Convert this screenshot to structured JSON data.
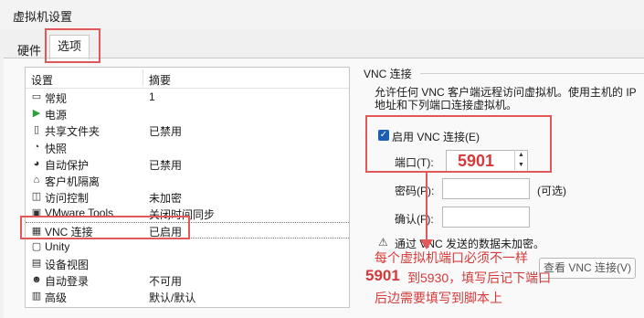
{
  "window": {
    "title": "虚拟机设置"
  },
  "tabs": [
    {
      "label": "硬件"
    },
    {
      "label": "选项"
    }
  ],
  "list": {
    "header_setting": "设置",
    "header_summary": "摘要",
    "rows": [
      {
        "icon": "general-icon",
        "glyph": "▭",
        "label": "常规",
        "summary": "1"
      },
      {
        "icon": "power-icon",
        "glyph": "▶",
        "label": "电源",
        "summary": ""
      },
      {
        "icon": "shared-folder-icon",
        "glyph": "▯",
        "label": "共享文件夹",
        "summary": "已禁用"
      },
      {
        "icon": "snapshot-icon",
        "glyph": "◔",
        "label": "快照",
        "summary": ""
      },
      {
        "icon": "autoprotect-icon",
        "glyph": "◕",
        "label": "自动保护",
        "summary": "已禁用"
      },
      {
        "icon": "lock-icon",
        "glyph": "⌂",
        "label": "客户机隔离",
        "summary": ""
      },
      {
        "icon": "access-control-icon",
        "glyph": "◫",
        "label": "访问控制",
        "summary": "未加密"
      },
      {
        "icon": "vmware-tools-icon",
        "glyph": "▣",
        "label": "VMware Tools",
        "summary": "关闭时间同步"
      },
      {
        "icon": "vnc-icon",
        "glyph": "▦",
        "label": "VNC 连接",
        "summary": "已启用"
      },
      {
        "icon": "unity-icon",
        "glyph": "▢",
        "label": "Unity",
        "summary": ""
      },
      {
        "icon": "device-view-icon",
        "glyph": "▤",
        "label": "设备视图",
        "summary": ""
      },
      {
        "icon": "autologin-icon",
        "glyph": "☻",
        "label": "自动登录",
        "summary": "不可用"
      },
      {
        "icon": "advanced-icon",
        "glyph": "▥",
        "label": "高级",
        "summary": "默认/默认"
      }
    ]
  },
  "vnc": {
    "group_title": "VNC 连接",
    "description": "允许任何 VNC 客户端远程访问虚拟机。使用主机的 IP 地址和下列端口连接虚拟机。",
    "enable_label": "启用 VNC 连接(E)",
    "port_label": "端口(T):",
    "port_value": "5901",
    "password_label": "密码(P):",
    "optional_label": "(可选)",
    "confirm_label": "确认(F):",
    "warning_text": "通过 VNC 发送的数据未加密。",
    "view_button": "查看 VNC 连接(V)"
  },
  "annotations": {
    "line1": "每个虚拟机端口必须不一样",
    "line2_prefix": "5901",
    "line2_rest": "到5930，填写后记下端口",
    "line3": "后边需要填写到脚本上"
  },
  "colors": {
    "annotation_red": "#e25757",
    "checkbox_blue": "#1a5fb4"
  }
}
